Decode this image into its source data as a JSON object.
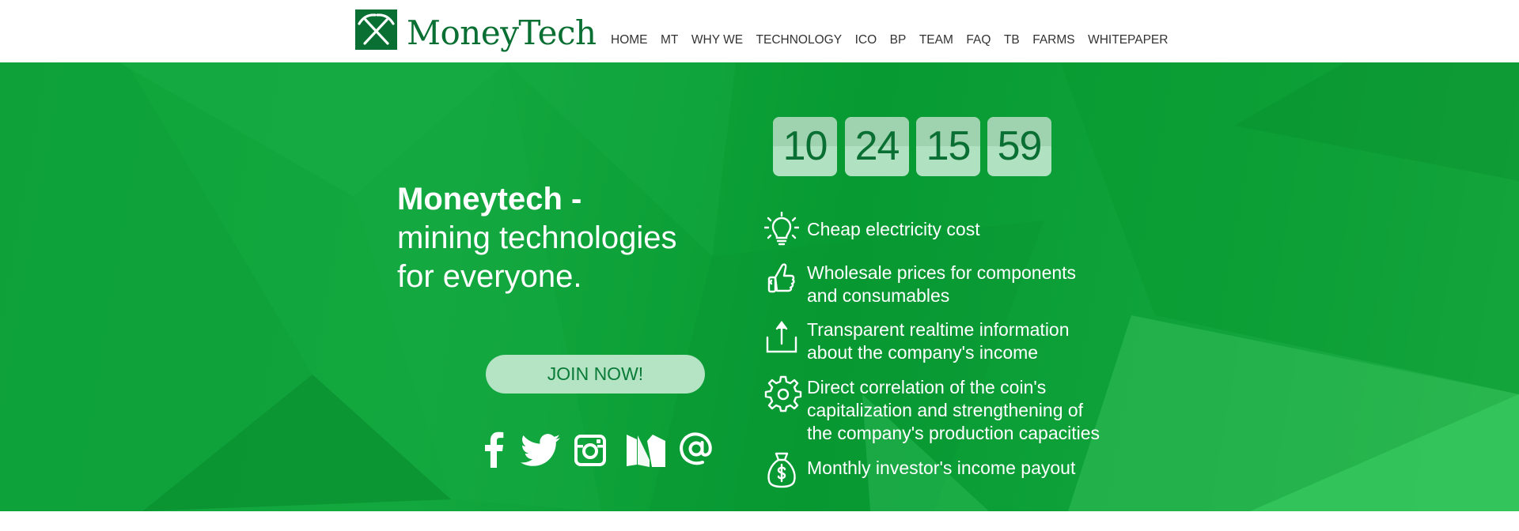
{
  "brand": {
    "name": "MoneyTech",
    "logo_icon": "crossed-pickaxes-icon",
    "color": "#0a6f33"
  },
  "nav": [
    "HOME",
    "MT",
    "WHY WE",
    "TECHNOLOGY",
    "ICO",
    "BP",
    "TEAM",
    "FAQ",
    "TB",
    "FARMS",
    "WHITEPAPER"
  ],
  "hero": {
    "title_line1": "Moneytech -",
    "title_line2": "mining technologies",
    "title_line3": "for everyone.",
    "cta_label": "JOIN NOW!",
    "background_color": "#0b9f37",
    "cta_color": "#b4e4c4"
  },
  "social": [
    "facebook-icon",
    "twitter-icon",
    "instagram-icon",
    "medium-icon",
    "email-at-icon"
  ],
  "countdown": [
    "10",
    "24",
    "15",
    "59"
  ],
  "features": [
    {
      "icon": "lightbulb-icon",
      "lines": [
        "Cheap electricity cost"
      ]
    },
    {
      "icon": "thumbs-up-icon",
      "lines": [
        "Wholesale prices for components",
        "and consumables"
      ]
    },
    {
      "icon": "upload-arrow-icon",
      "lines": [
        "Transparent realtime information",
        "about the company's income"
      ]
    },
    {
      "icon": "gear-icon",
      "lines": [
        "Direct correlation of the coin's",
        "capitalization and strengthening of",
        "the company's production capacities"
      ]
    },
    {
      "icon": "money-bag-icon",
      "lines": [
        "Monthly investor's income payout"
      ]
    }
  ]
}
